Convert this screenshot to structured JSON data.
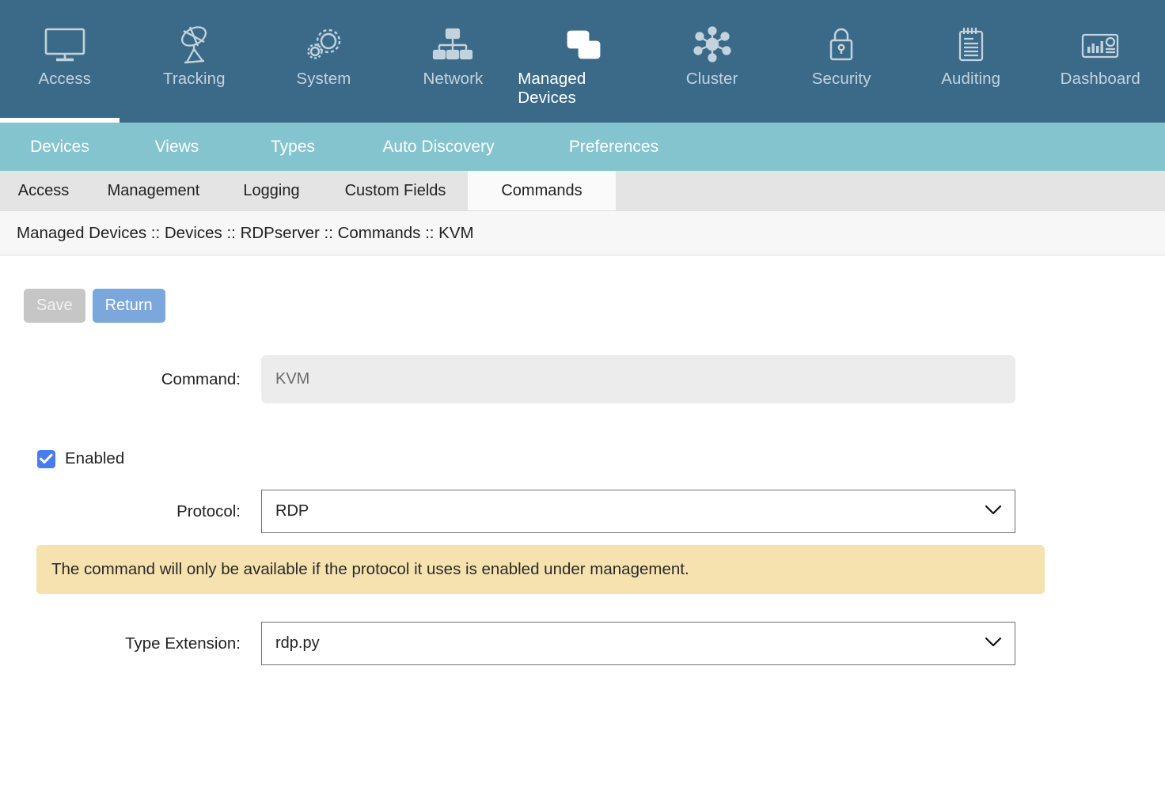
{
  "topnav": {
    "items": [
      {
        "label": "Access",
        "icon": "monitor-icon",
        "active": false
      },
      {
        "label": "Tracking",
        "icon": "satellite-dish-icon",
        "active": false
      },
      {
        "label": "System",
        "icon": "gears-icon",
        "active": false
      },
      {
        "label": "Network",
        "icon": "sitemap-icon",
        "active": false
      },
      {
        "label": "Managed Devices",
        "icon": "windows-stack-icon",
        "active": true
      },
      {
        "label": "Cluster",
        "icon": "hub-nodes-icon",
        "active": false
      },
      {
        "label": "Security",
        "icon": "padlock-icon",
        "active": false
      },
      {
        "label": "Auditing",
        "icon": "notepad-icon",
        "active": false
      },
      {
        "label": "Dashboard",
        "icon": "dashboard-chart-icon",
        "active": false
      }
    ]
  },
  "subnav": {
    "items": [
      {
        "label": "Devices",
        "active": true
      },
      {
        "label": "Views",
        "active": false
      },
      {
        "label": "Types",
        "active": false
      },
      {
        "label": "Auto Discovery",
        "active": false
      },
      {
        "label": "Preferences",
        "active": false
      }
    ]
  },
  "tabs": {
    "items": [
      {
        "label": "Access",
        "active": false
      },
      {
        "label": "Management",
        "active": false
      },
      {
        "label": "Logging",
        "active": false
      },
      {
        "label": "Custom Fields",
        "active": false
      },
      {
        "label": "Commands",
        "active": true
      }
    ]
  },
  "breadcrumb": {
    "text": "Managed Devices :: Devices :: RDPserver :: Commands :: KVM"
  },
  "toolbar": {
    "save_label": "Save",
    "return_label": "Return"
  },
  "form": {
    "command": {
      "label": "Command:",
      "value": "KVM",
      "readonly": true
    },
    "enabled": {
      "label": "Enabled",
      "checked": true,
      "checkmark": "✔"
    },
    "protocol": {
      "label": "Protocol:",
      "value": "RDP"
    },
    "notice": {
      "text": "The command will only be available if the protocol it uses is enabled under management."
    },
    "type_extension": {
      "label": "Type Extension:",
      "value": "rdp.py"
    }
  },
  "colors": {
    "topnav_bg": "#3b6a89",
    "subnav_bg": "#84c4cf",
    "tabstrip_bg": "#e4e4e4",
    "active_tab_bg": "#fafafa",
    "breadcrumb_bg": "#f7f7f7",
    "return_button": "#7ba7dc",
    "save_button": "#c6c6c6",
    "checkbox_blue": "#4a7cf0",
    "notice_bg": "#f6e2ae"
  }
}
